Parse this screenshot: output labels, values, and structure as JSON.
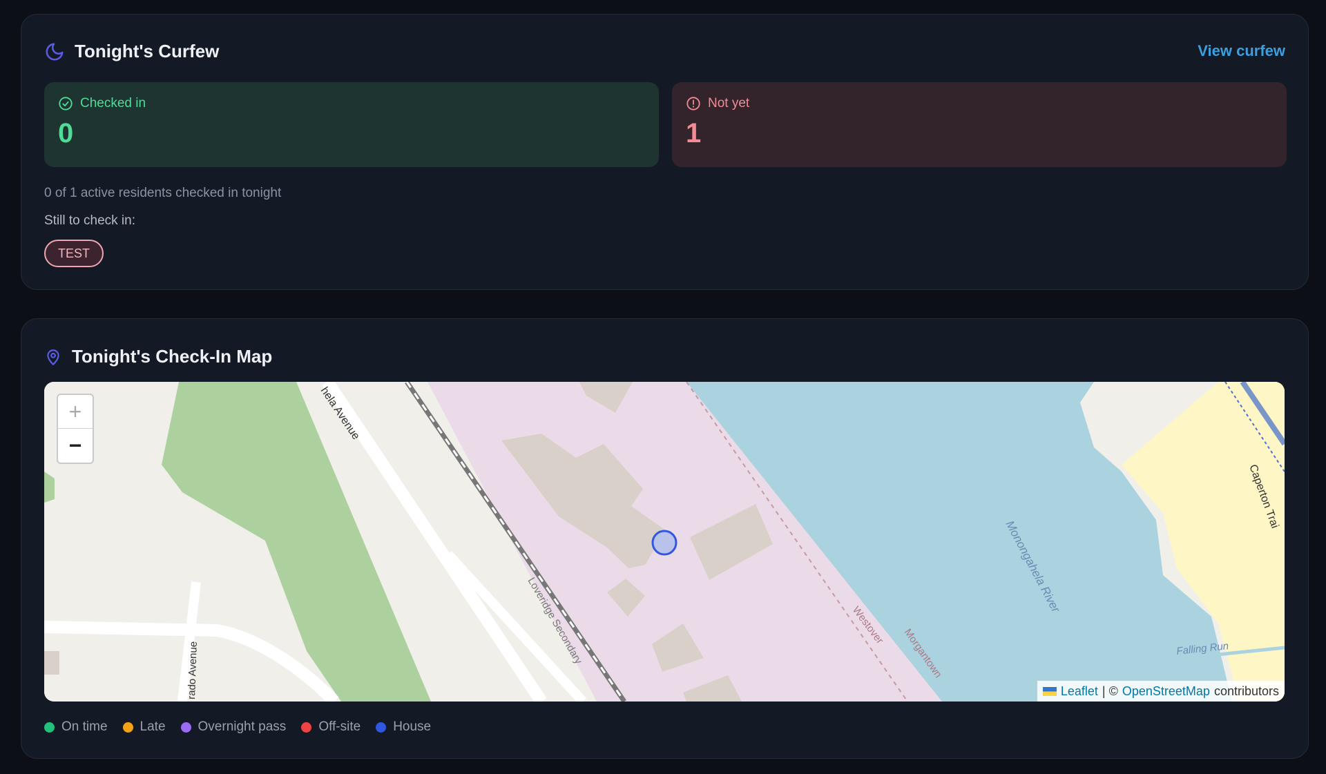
{
  "curfew": {
    "title": "Tonight's Curfew",
    "view_link": "View curfew",
    "checked_in": {
      "label": "Checked in",
      "value": "0"
    },
    "not_yet": {
      "label": "Not yet",
      "value": "1"
    },
    "summary": "0 of 1 active residents checked in tonight",
    "still_label": "Still to check in:",
    "pending": [
      "TEST"
    ]
  },
  "map_card": {
    "title": "Tonight's Check-In Map",
    "zoom_in": "+",
    "zoom_out": "−",
    "labels": {
      "road1": "hela Avenue",
      "road2": "Loveridge Secondary",
      "road3": "rado Avenue",
      "road4": "Westover",
      "road5": "Morgantown",
      "river": "Monongahela River",
      "creek": "Falling Run",
      "trail": "Caperton Trai"
    },
    "attribution": {
      "leaflet": "Leaflet",
      "sep": "| ©",
      "osm": "OpenStreetMap",
      "tail": "contributors"
    }
  },
  "legend": [
    {
      "label": "On time",
      "color": "#22c07a"
    },
    {
      "label": "Late",
      "color": "#f5a316"
    },
    {
      "label": "Overnight pass",
      "color": "#9b6cf2"
    },
    {
      "label": "Off-site",
      "color": "#ef4444"
    },
    {
      "label": "House",
      "color": "#2f57e0"
    }
  ],
  "colors": {
    "accent": "#5b5ce6",
    "link": "#3b9fe0"
  }
}
